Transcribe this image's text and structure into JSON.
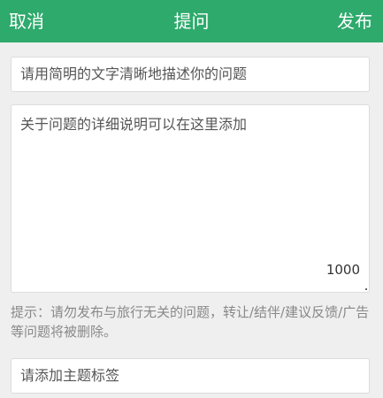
{
  "header": {
    "cancel_label": "取消",
    "title": "提问",
    "publish_label": "发布",
    "bg_color": "#2eaa6c"
  },
  "form": {
    "title_placeholder": "请用简明的文字清晰地描述你的问题",
    "description_placeholder": "关于问题的详细说明可以在这里添加",
    "char_counter": "1000",
    "tip": "提示：请勿发布与旅行无关的问题，转让/结伴/建议反馈/广告等问题将被删除。",
    "tag_placeholder": "请添加主题标签"
  }
}
